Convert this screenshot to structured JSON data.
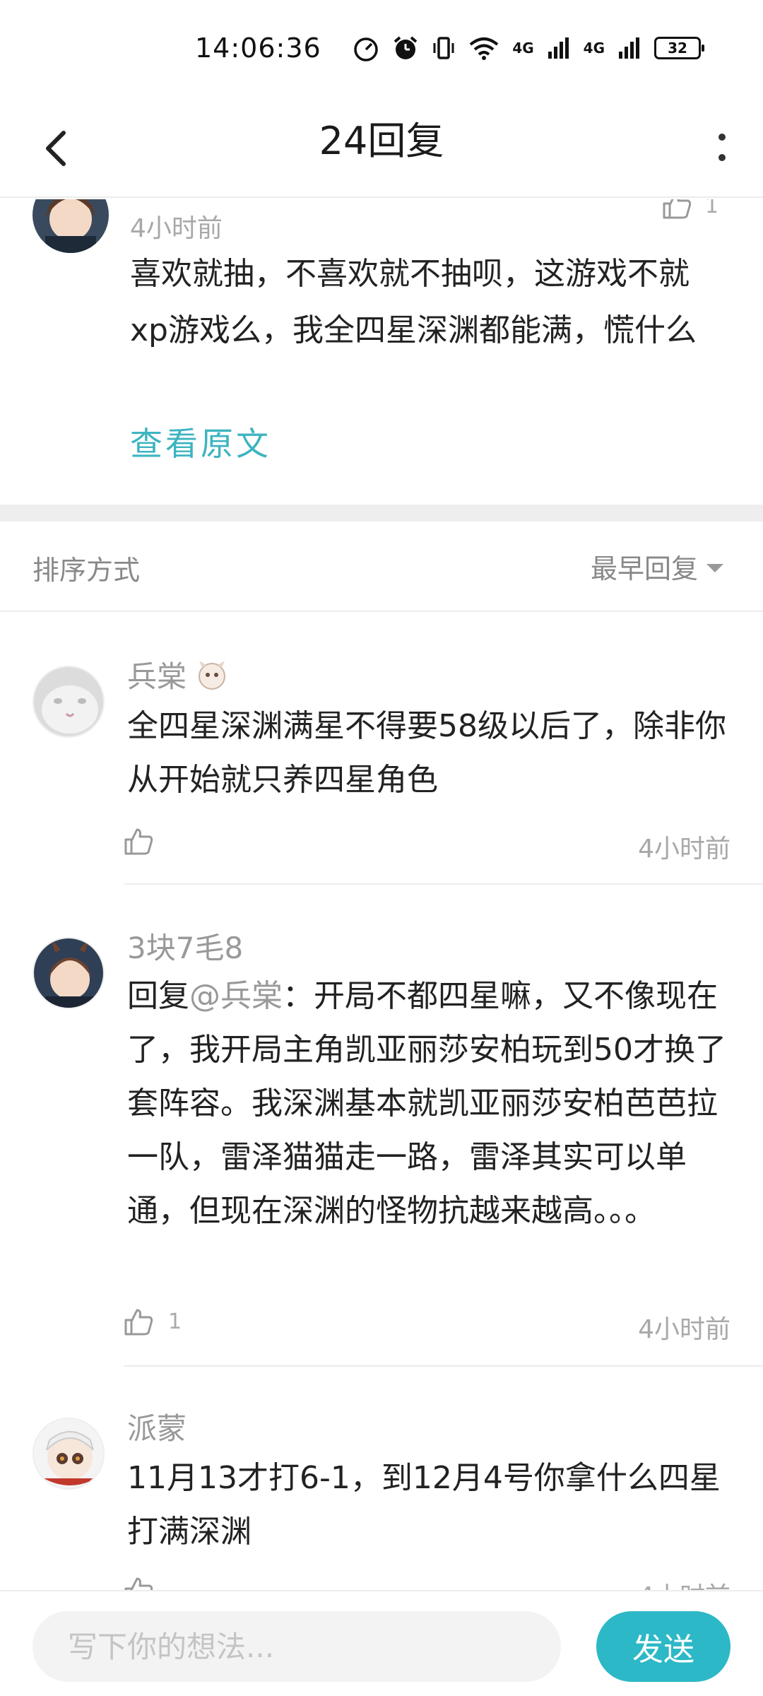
{
  "status_bar": {
    "time": "14:06:36",
    "network": "4G",
    "battery": "32"
  },
  "header": {
    "title": "24回复"
  },
  "op_comment": {
    "time": "4小时前",
    "like_count": "1",
    "text": "喜欢就抽，不喜欢就不抽呗，这游戏不就xp游戏么，我全四星深渊都能满，慌什么",
    "view_original_label": "查看原文"
  },
  "sort_bar": {
    "label": "排序方式",
    "value": "最早回复"
  },
  "replies": [
    {
      "name": "兵棠",
      "text": "全四星深渊满星不得要58级以后了，除非你从开始就只养四星角色",
      "like_count": "",
      "time": "4小时前"
    },
    {
      "name": "3块7毛8",
      "reply_prefix": "回复",
      "mention": "@兵棠",
      "text": "：开局不都四星嘛，又不像现在了，我开局主角凯亚丽莎安柏玩到50才换了套阵容。我深渊基本就凯亚丽莎安柏芭芭拉一队，雷泽猫猫走一路，雷泽其实可以单通，但现在深渊的怪物抗越来越高。。。",
      "like_count": "1",
      "time": "4小时前"
    },
    {
      "name": "派蒙",
      "text": "11月13才打6-1，到12月4号你拿什么四星打满深渊",
      "like_count": "",
      "time": "4小时前"
    }
  ],
  "input": {
    "placeholder": "写下你的想法...",
    "send_label": "发送"
  },
  "colors": {
    "accent": "#2cb8c6",
    "link": "#3cb4c0"
  },
  "icons": [
    "back-arrow-icon",
    "more-vertical-icon",
    "thumbs-up-icon",
    "caret-down-icon",
    "alarm-icon",
    "wifi-icon",
    "battery-icon"
  ]
}
